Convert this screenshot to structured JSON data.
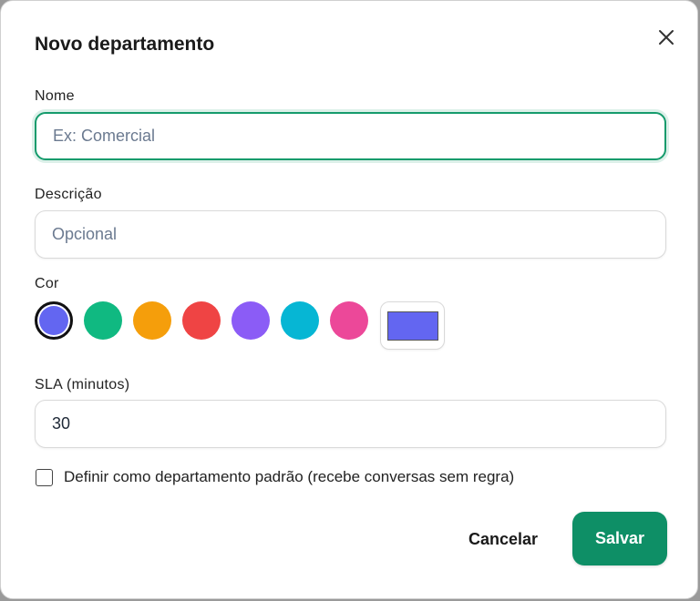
{
  "dialog": {
    "title": "Novo departamento"
  },
  "fields": {
    "name": {
      "label": "Nome",
      "placeholder": "Ex: Comercial",
      "value": ""
    },
    "description": {
      "label": "Descrição",
      "placeholder": "Opcional",
      "value": ""
    },
    "color": {
      "label": "Cor",
      "options": [
        "#6366f1",
        "#10b981",
        "#f59e0b",
        "#ef4444",
        "#8b5cf6",
        "#06b6d4",
        "#ec4899"
      ],
      "selected": "#6366f1",
      "custom_value": "#6366f1"
    },
    "sla": {
      "label": "SLA (minutos)",
      "value": "30"
    }
  },
  "default_checkbox": {
    "label": "Definir como departamento padrão (recebe conversas sem regra)",
    "checked": false
  },
  "actions": {
    "cancel_label": "Cancelar",
    "save_label": "Salvar"
  },
  "icons": {
    "close": "close-icon"
  },
  "colors": {
    "accent": "#0e8f66",
    "focus_border": "#159b6c"
  }
}
